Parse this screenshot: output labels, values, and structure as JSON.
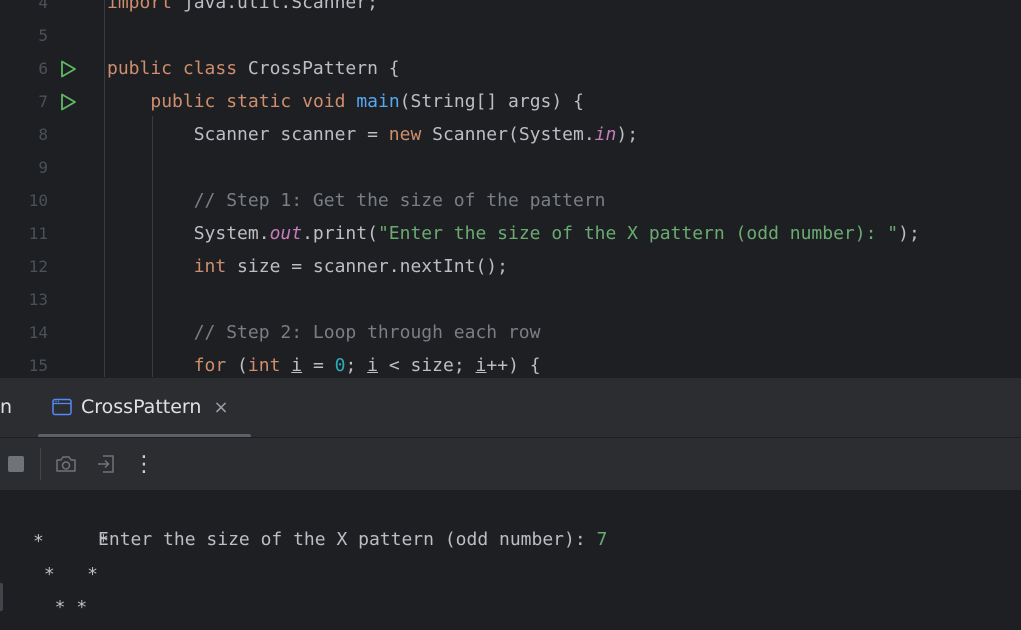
{
  "editor": {
    "lines": [
      {
        "num": "4",
        "code": [
          {
            "t": "import",
            "cls": "k"
          },
          {
            "t": " java.util.Scanner;"
          }
        ]
      },
      {
        "num": "5",
        "code": []
      },
      {
        "num": "6",
        "run": true,
        "code": [
          {
            "t": "public",
            "cls": "k"
          },
          {
            "t": " "
          },
          {
            "t": "class",
            "cls": "k"
          },
          {
            "t": " CrossPattern {"
          }
        ]
      },
      {
        "num": "7",
        "run": true,
        "code": [
          {
            "t": "    "
          },
          {
            "t": "public",
            "cls": "k"
          },
          {
            "t": " "
          },
          {
            "t": "static",
            "cls": "k"
          },
          {
            "t": " "
          },
          {
            "t": "void",
            "cls": "k"
          },
          {
            "t": " "
          },
          {
            "t": "main",
            "cls": "m"
          },
          {
            "t": "(String[] args) {"
          }
        ]
      },
      {
        "num": "8",
        "code": [
          {
            "t": "        Scanner scanner = "
          },
          {
            "t": "new",
            "cls": "k"
          },
          {
            "t": " Scanner(System."
          },
          {
            "t": "in",
            "cls": "f"
          },
          {
            "t": ");"
          }
        ]
      },
      {
        "num": "9",
        "code": []
      },
      {
        "num": "10",
        "code": [
          {
            "t": "        "
          },
          {
            "t": "// Step 1: Get the size of the pattern",
            "cls": "c"
          }
        ]
      },
      {
        "num": "11",
        "code": [
          {
            "t": "        System."
          },
          {
            "t": "out",
            "cls": "f"
          },
          {
            "t": ".print("
          },
          {
            "t": "\"Enter the size of the X pattern (odd number): \"",
            "cls": "s"
          },
          {
            "t": ");"
          }
        ]
      },
      {
        "num": "12",
        "code": [
          {
            "t": "        "
          },
          {
            "t": "int",
            "cls": "k"
          },
          {
            "t": " size = scanner.nextInt();"
          }
        ]
      },
      {
        "num": "13",
        "code": []
      },
      {
        "num": "14",
        "code": [
          {
            "t": "        "
          },
          {
            "t": "// Step 2: Loop through each row",
            "cls": "c"
          }
        ]
      },
      {
        "num": "15",
        "code": [
          {
            "t": "        "
          },
          {
            "t": "for",
            "cls": "k"
          },
          {
            "t": " ("
          },
          {
            "t": "int",
            "cls": "k"
          },
          {
            "t": " "
          },
          {
            "t": "i",
            "cls": "u"
          },
          {
            "t": " = "
          },
          {
            "t": "0",
            "cls": "n"
          },
          {
            "t": "; "
          },
          {
            "t": "i",
            "cls": "u"
          },
          {
            "t": " < size; "
          },
          {
            "t": "i",
            "cls": "u"
          },
          {
            "t": "++) {"
          }
        ]
      }
    ]
  },
  "run_panel": {
    "left_label": "n",
    "tab_title": "CrossPattern",
    "tab_close": "×",
    "toolbar": {
      "stop_icon": "stop-icon",
      "camera_icon": "camera-icon",
      "exit_icon": "exit-icon",
      "more_icon": "more-vertical-icon",
      "more_glyph": "⋮"
    },
    "console": {
      "prompt": "Enter the size of the X pattern (odd number): ",
      "input": "7",
      "output": [
        "*     *",
        " *   *",
        "  * *"
      ]
    }
  },
  "colors": {
    "keyword": "#cf8e6d",
    "method": "#56a8f5",
    "string": "#6aab73",
    "number": "#2aacb8",
    "comment": "#7a7e85",
    "field": "#c77dbb",
    "text": "#bcbec4",
    "run_icon": "#5fb865"
  }
}
